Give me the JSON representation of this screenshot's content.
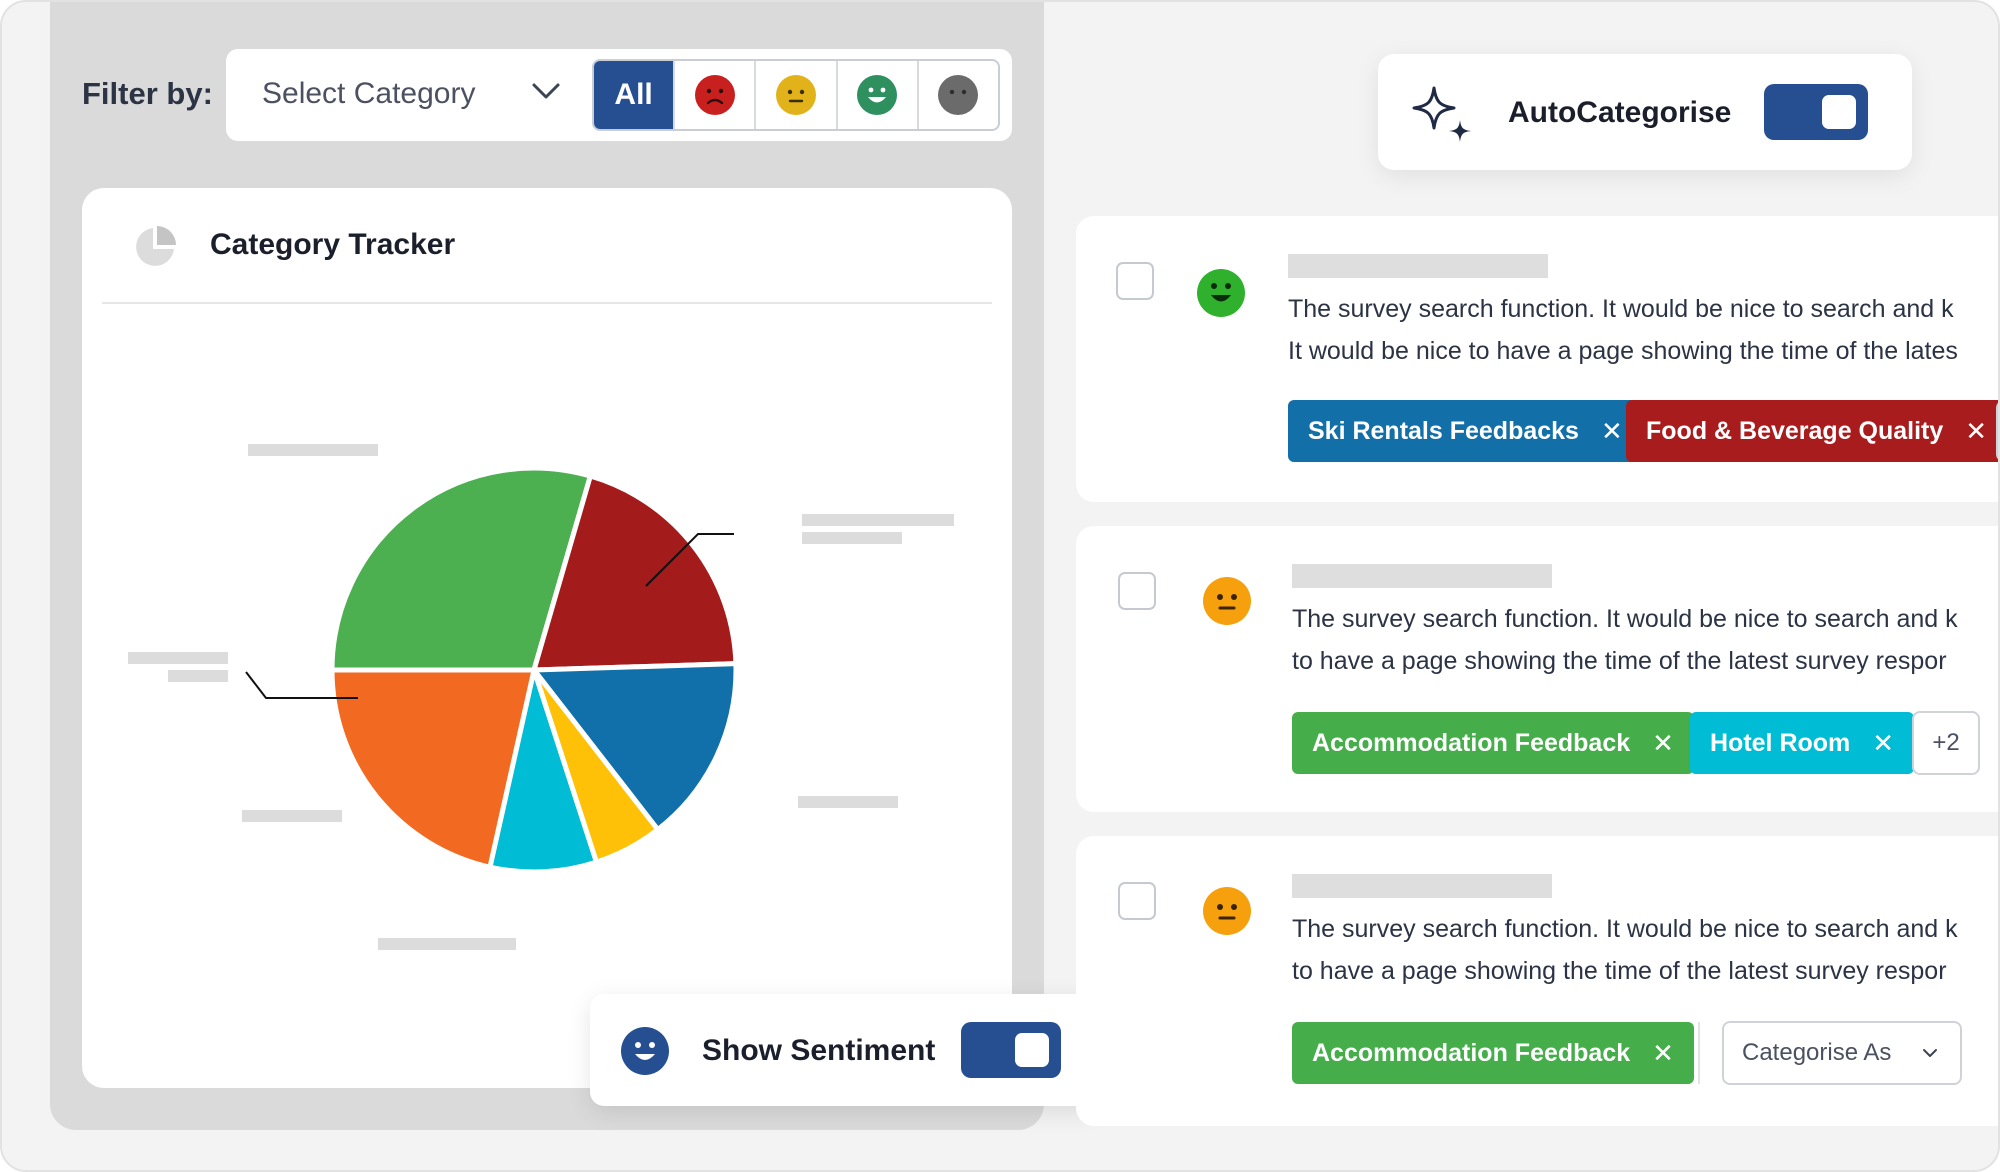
{
  "filter": {
    "label": "Filter by:",
    "category_placeholder": "Select Category",
    "all_label": "All"
  },
  "tracker": {
    "title": "Category Tracker"
  },
  "sentiment_toggle": {
    "label": "Show Sentiment",
    "enabled": true
  },
  "auto": {
    "label": "AutoCategorise",
    "enabled": true
  },
  "colors": {
    "accent": "#264f92",
    "negative": "#c81f1f",
    "neutral": "#f5a00c",
    "positive": "#2fb12e",
    "unknown": "#6b6b6b",
    "pie_green": "#4caf50",
    "pie_red": "#a31b1b",
    "pie_blue": "#1170aa",
    "pie_yellow": "#ffc107",
    "pie_cyan": "#00bcd4",
    "pie_orange": "#f26a22"
  },
  "responses": [
    {
      "sentiment": "positive",
      "line1": "The survey search function. It would be nice to search and k",
      "line2": "It would be nice to have a page showing the time of the lates",
      "tags": [
        {
          "label": "Ski Rentals Feedbacks",
          "color": "#136fa8"
        },
        {
          "label": "Food & Beverage Quality",
          "color": "#a81c1e"
        }
      ]
    },
    {
      "sentiment": "neutral",
      "line1": "The survey search function. It would be nice to search and k",
      "line2": "to have a page showing the time of the latest survey respor",
      "tags": [
        {
          "label": "Accommodation Feedback",
          "color": "#46ad4b"
        },
        {
          "label": "Hotel Room",
          "color": "#00bcd4"
        }
      ],
      "more": "+2"
    },
    {
      "sentiment": "neutral",
      "line1": "The survey search function. It would be nice to search and k",
      "line2": "to have a page showing the time of the latest survey respor",
      "tags": [
        {
          "label": "Accommodation Feedback",
          "color": "#46ad4b"
        }
      ],
      "dropdown": "Categorise As"
    }
  ],
  "chart_data": {
    "type": "pie",
    "title": "Category Tracker",
    "slices": [
      {
        "value": 29.5,
        "color": "#4caf50"
      },
      {
        "value": 20.0,
        "color": "#a31b1b"
      },
      {
        "value": 15.0,
        "color": "#1170aa"
      },
      {
        "value": 5.5,
        "color": "#ffc107"
      },
      {
        "value": 8.5,
        "color": "#00bcd4"
      },
      {
        "value": 21.5,
        "color": "#f26a22"
      }
    ]
  }
}
